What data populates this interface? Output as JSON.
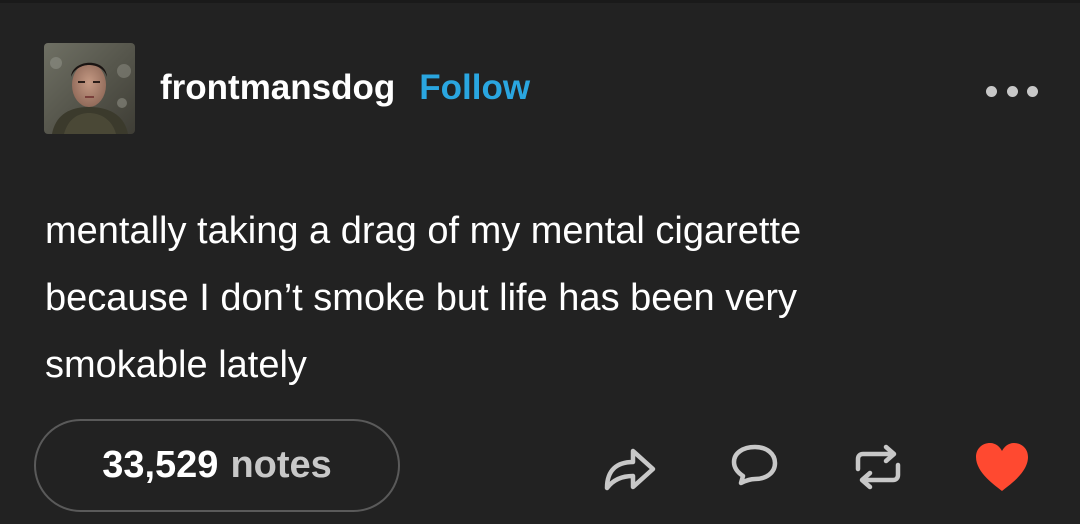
{
  "post": {
    "author": {
      "username": "frontmansdog",
      "follow_label": "Follow"
    },
    "body": "mentally taking a drag of my mental cigarette\nbecause I don’t smoke but life has been very\nsmokable lately",
    "notes": {
      "count": "33,529",
      "label": "notes"
    },
    "actions": {
      "share_icon": "share-icon",
      "reply_icon": "reply-icon",
      "reblog_icon": "reblog-icon",
      "like_icon": "heart-icon",
      "like_state": "liked"
    }
  },
  "colors": {
    "background": "#222222",
    "text": "#ffffff",
    "follow_link": "#2aa6e0",
    "secondary_text": "#c8c8c8",
    "like_active": "#ff4930"
  }
}
